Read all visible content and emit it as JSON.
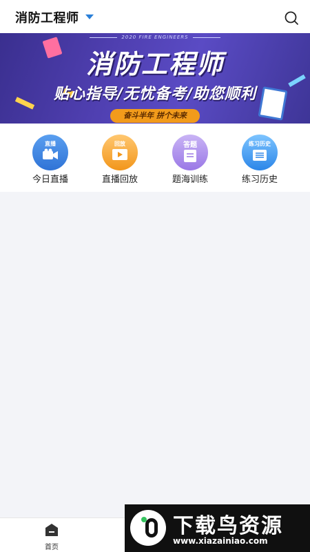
{
  "header": {
    "title": "消防工程师"
  },
  "banner": {
    "year_text": "2020 FIRE ENGINEERS",
    "title": "消防工程师",
    "subtitle": "贴心指导/无忧备考/助您顺利",
    "tag": "奋斗半年 拼个未来"
  },
  "quick_menu": [
    {
      "label": "今日直播",
      "badge": "直播",
      "icon": "video-camera-icon",
      "color": "#2f73d6"
    },
    {
      "label": "直播回放",
      "badge": "回放",
      "icon": "play-icon",
      "color": "#f2961b"
    },
    {
      "label": "题海训练",
      "badge": "答题",
      "icon": "document-icon",
      "color": "#9a78e6"
    },
    {
      "label": "练习历史",
      "badge": "练习历史",
      "icon": "history-list-icon",
      "color": "#2c86e8"
    }
  ],
  "bottom_nav": {
    "home_label": "首页"
  },
  "watermark": {
    "title": "下载鸟资源",
    "url": "www.xiazainiao.com"
  }
}
